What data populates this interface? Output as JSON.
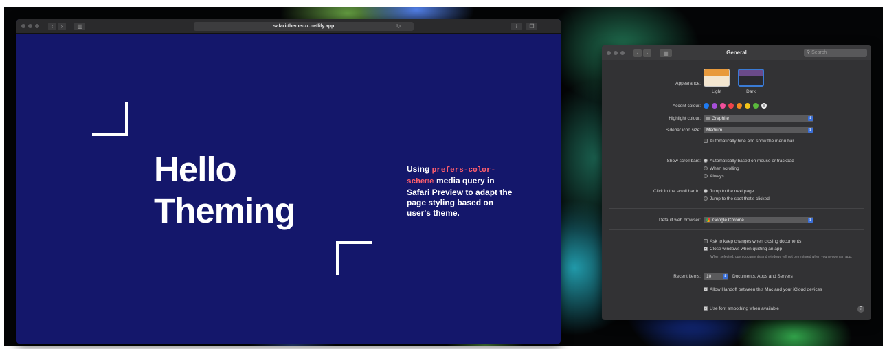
{
  "safari": {
    "url": "safari-theme-ux.netlify.app",
    "hello_line1": "Hello",
    "hello_line2": "Theming",
    "desc_pre": "Using ",
    "desc_code": "prefers-color-scheme",
    "desc_post": " media query in Safari Preview to adapt the page styling based on user's theme."
  },
  "prefs": {
    "title": "General",
    "search_placeholder": "Search",
    "appearance_label": "Appearance:",
    "appearance_light": "Light",
    "appearance_dark": "Dark",
    "accent_label": "Accent colour:",
    "accent_colors": [
      "#1f7bf2",
      "#a64fd8",
      "#f0509c",
      "#f0434b",
      "#f48b1f",
      "#f5c518",
      "#5ab93c",
      "#9a9a9a"
    ],
    "highlight_label": "Highlight colour:",
    "highlight_value": "Graphite",
    "sidebar_label": "Sidebar icon size:",
    "sidebar_value": "Medium",
    "menubar_option": "Automatically hide and show the menu bar",
    "scrollbars_label": "Show scroll bars:",
    "scroll_opt1": "Automatically based on mouse or trackpad",
    "scroll_opt2": "When scrolling",
    "scroll_opt3": "Always",
    "click_label": "Click in the scroll bar to:",
    "click_opt1": "Jump to the next page",
    "click_opt2": "Jump to the spot that's clicked",
    "browser_label": "Default web browser:",
    "browser_value": "Google Chrome",
    "ask_keep": "Ask to keep changes when closing documents",
    "close_windows": "Close windows when quitting an app",
    "close_note": "When selected, open documents and windows will not be restored when you re-open an app.",
    "recent_label": "Recent items:",
    "recent_value": "10",
    "recent_suffix": "Documents, Apps and Servers",
    "handoff": "Allow Handoff between this Mac and your iCloud devices",
    "font_smoothing": "Use font smoothing when available",
    "help_glyph": "?"
  }
}
